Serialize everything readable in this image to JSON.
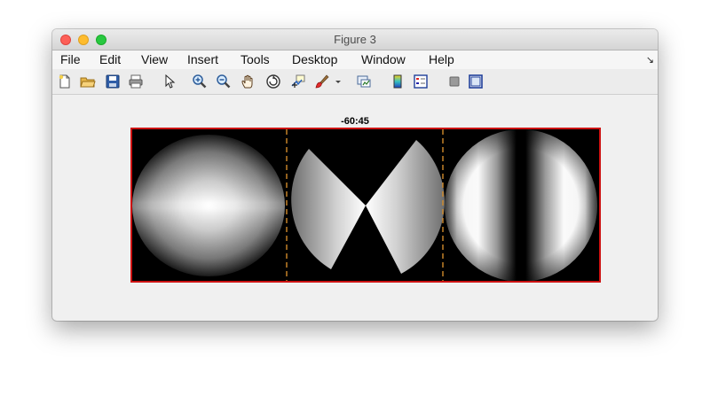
{
  "window": {
    "title": "Figure 3"
  },
  "menu": {
    "items": [
      "File",
      "Edit",
      "View",
      "Insert",
      "Tools",
      "Desktop",
      "Window",
      "Help"
    ],
    "corner_icon": "dock-arrow-icon"
  },
  "toolbar": {
    "buttons": [
      "new-figure-icon",
      "open-file-icon",
      "save-icon",
      "print-icon",
      "pointer-icon",
      "zoom-in-icon",
      "zoom-out-icon",
      "pan-hand-icon",
      "rotate-3d-icon",
      "data-cursor-icon",
      "brush-icon",
      "dropdown-arrow-icon",
      "link-plot-icon",
      "colorbar-icon",
      "legend-icon",
      "hide-plot-tools-icon",
      "show-plot-tools-icon"
    ]
  },
  "plot": {
    "title": "-60:45",
    "colors": {
      "border": "#cc1111",
      "divider": "#d08a2a",
      "background": "#000000"
    },
    "panels": [
      "radial-gradient-ellipse",
      "bowtie-wedges",
      "striped-disk"
    ]
  }
}
